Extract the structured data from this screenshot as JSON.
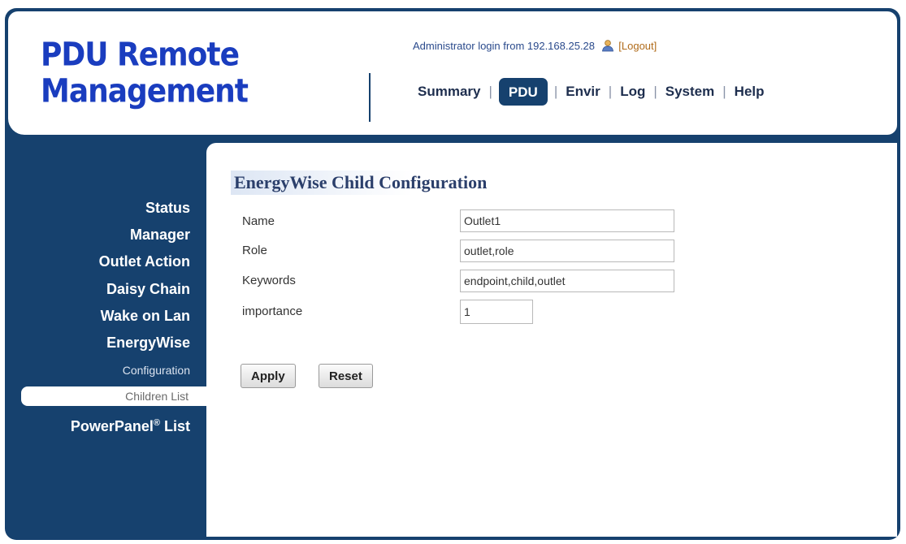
{
  "header": {
    "logo_line1": "PDU Remote",
    "logo_line2": "Management",
    "login_text": "Administrator login from 192.168.25.28",
    "logout_label": "[Logout]"
  },
  "topnav": {
    "tabs": [
      {
        "label": "Summary"
      },
      {
        "label": "PDU",
        "active": true
      },
      {
        "label": "Envir"
      },
      {
        "label": "Log"
      },
      {
        "label": "System"
      },
      {
        "label": "Help"
      }
    ],
    "separator": "|"
  },
  "sidebar": {
    "items": [
      {
        "label": "Status"
      },
      {
        "label": "Manager"
      },
      {
        "label": "Outlet Action"
      },
      {
        "label": "Daisy Chain"
      },
      {
        "label": "Wake on Lan"
      },
      {
        "label": "EnergyWise"
      }
    ],
    "subitems": [
      {
        "label": "Configuration"
      },
      {
        "label": "Children List",
        "selected": true
      }
    ],
    "powerpanel_label": "PowerPanel",
    "powerpanel_reg": "®",
    "powerpanel_suffix": " List"
  },
  "form": {
    "title": "EnergyWise Child Configuration",
    "fields": [
      {
        "label": "Name",
        "value": "Outlet1"
      },
      {
        "label": "Role",
        "value": "outlet,role"
      },
      {
        "label": "Keywords",
        "value": "endpoint,child,outlet"
      },
      {
        "label": "importance",
        "value": "1"
      }
    ],
    "apply_label": "Apply",
    "reset_label": "Reset"
  },
  "colors": {
    "brand_navy": "#16416e",
    "logo_blue": "#1a3dbf",
    "logout_orange": "#b06b1a"
  },
  "icons": {
    "user": "user-icon"
  }
}
